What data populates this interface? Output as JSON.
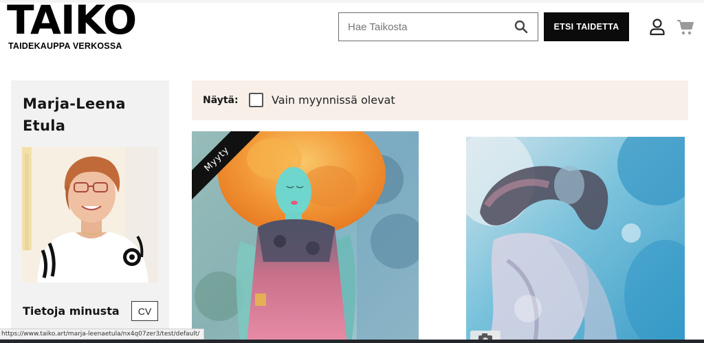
{
  "logo": {
    "word": "TAIKO",
    "tagline": "TAIDEKAUPPA VERKOSSA"
  },
  "search": {
    "placeholder": "Hae Taikosta",
    "icon": "search-icon"
  },
  "header": {
    "search_button_label": "ETSI TAIDETTA",
    "user_icon": "user-icon",
    "cart_icon": "cart-icon"
  },
  "artist": {
    "name": "Marja-Leena Etula",
    "about_title": "Tietoja minusta",
    "cv_label": "CV"
  },
  "filter": {
    "label": "Näytä:",
    "checkbox_label": "Vain myynnissä olevat",
    "checked": false
  },
  "artworks": [
    {
      "badge": "Myyty"
    },
    {
      "badge": ""
    }
  ],
  "status_bar": {
    "url": "https://www.taiko.art/marja-leenaetula/nx4q07zer3/test/default/"
  },
  "colors": {
    "accent": "#0b0b0b",
    "panel": "#f2f2f2",
    "filter_bg": "#f7efe8"
  }
}
